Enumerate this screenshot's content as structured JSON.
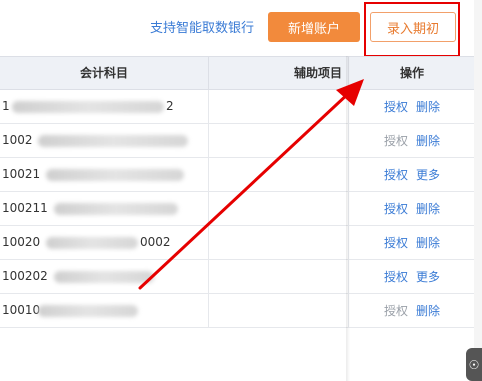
{
  "toolbar": {
    "bank_link": "支持智能取数银行",
    "add_account_label": "新增账户",
    "enter_opening_label": "录入期初"
  },
  "table": {
    "headers": {
      "subject": "会计科目",
      "auxiliary": "辅助项目",
      "operations": "操作"
    },
    "rows": [
      {
        "code": "1",
        "tail": "2",
        "op1": "授权",
        "op1_disabled": false,
        "op2": "删除"
      },
      {
        "code": "1002",
        "tail": "",
        "op1": "授权",
        "op1_disabled": true,
        "op2": "删除"
      },
      {
        "code": "10021",
        "tail": "",
        "op1": "授权",
        "op1_disabled": false,
        "op2": "更多"
      },
      {
        "code": "100211",
        "tail": "",
        "op1": "授权",
        "op1_disabled": false,
        "op2": "删除"
      },
      {
        "code": "10020",
        "tail": "0002",
        "op1": "授权",
        "op1_disabled": false,
        "op2": "删除"
      },
      {
        "code": "100202",
        "tail": "",
        "op1": "授权",
        "op1_disabled": false,
        "op2": "更多"
      },
      {
        "code": "10010",
        "tail": "",
        "op1": "授权",
        "op1_disabled": true,
        "op2": "删除"
      }
    ]
  },
  "colors": {
    "primary_button": "#f28a3c",
    "link": "#3a7bd5",
    "annotation_red": "#e60000"
  }
}
